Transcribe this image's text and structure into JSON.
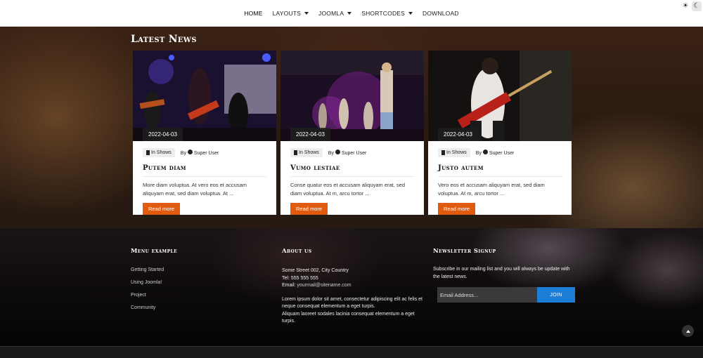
{
  "nav": {
    "items": [
      {
        "label": "HOME",
        "caret": false
      },
      {
        "label": "LAYOUTS",
        "caret": true
      },
      {
        "label": "JOOMLA",
        "caret": true
      },
      {
        "label": "SHORTCODES",
        "caret": true
      },
      {
        "label": "DOWNLOAD",
        "caret": false
      }
    ],
    "light_icon": "sun-icon",
    "dark_icon": "moon-icon"
  },
  "news": {
    "title": "Latest News",
    "by_label": "By",
    "cards": [
      {
        "date": "2022-04-03",
        "category": "In Shows",
        "author": "Super User",
        "title": "Putem diam",
        "text": "More diam voluptua. At vero eos et accusam aliquyam erat, sed diam voluptua. At ...",
        "button": "Read more"
      },
      {
        "date": "2022-04-03",
        "category": "In Shows",
        "author": "Super User",
        "title": "Vumo lestiae",
        "text": "Conse quatur eos et accusam aliquyam erat, sed diam voluptua. At m, arcu tortor ...",
        "button": "Read more"
      },
      {
        "date": "2022-04-03",
        "category": "In Shows",
        "author": "Super User",
        "title": "Justo autem",
        "text": "Vero eos et accusam aliquyam erat, sed diam voluptua. At m, arcu tortor ...",
        "button": "Read more"
      }
    ]
  },
  "footer": {
    "menu": {
      "heading": "Menu example",
      "items": [
        "Getting Started",
        "Using Joomla!",
        "Project",
        "Community"
      ]
    },
    "about": {
      "heading": "About us",
      "address": "Some Street 002, City Country",
      "tel": "Tel: 555 555 555",
      "email_label": "Email:",
      "email": "yourmail@sitename.com",
      "para1": "Lorem ipsum dolor sit amet, consectetur adipiscing elit ac felis et neque consequat elementum a eget turpis.",
      "para2": "Aliquam laoreet sodales lacinia consequat elementum a eget turpis."
    },
    "newsletter": {
      "heading": "Newsletter Signup",
      "text": "Subscribe in our mailing list and you will always be update with the latest news.",
      "placeholder": "Email Address...",
      "button": "JOIN"
    }
  },
  "colors": {
    "accent": "#e15b0e",
    "join": "#1d7ed8"
  }
}
